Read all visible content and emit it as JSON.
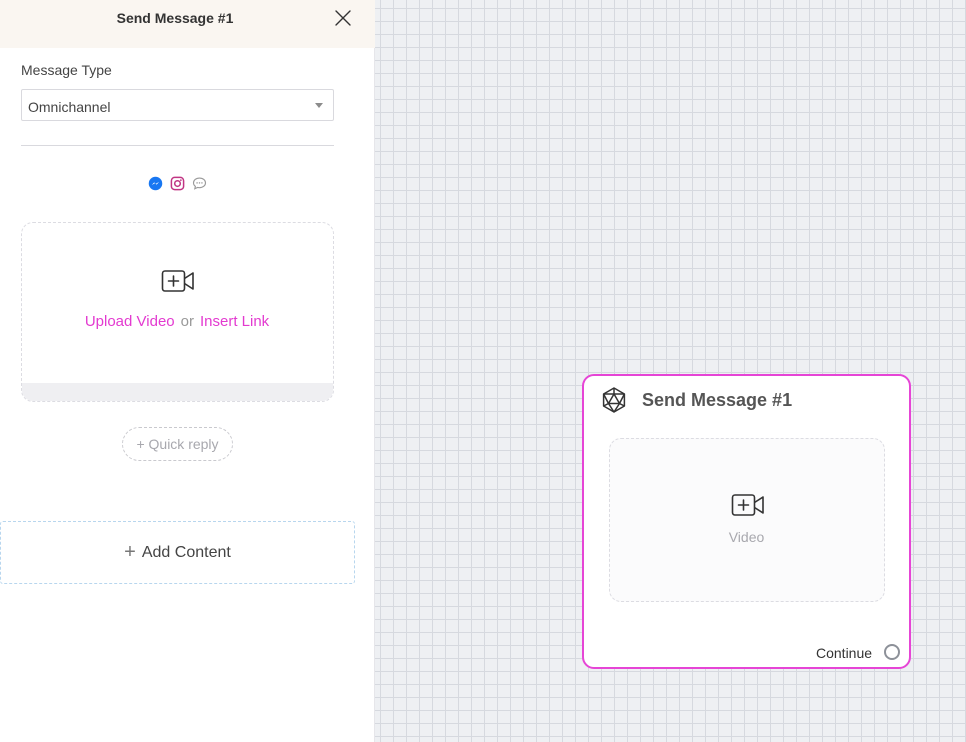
{
  "panel": {
    "title": "Send Message #1",
    "close_icon": "close-icon",
    "message_type": {
      "label": "Message Type",
      "value": "Omnichannel"
    },
    "channels": [
      {
        "name": "messenger",
        "icon": "messenger-icon",
        "color": "#1877f2"
      },
      {
        "name": "instagram",
        "icon": "instagram-icon",
        "color": "#c13584"
      },
      {
        "name": "sms",
        "icon": "chat-bubble-icon",
        "color": "#9a9a9a"
      }
    ],
    "upload": {
      "icon": "add-video-icon",
      "upload_label": "Upload Video",
      "or_label": "or",
      "link_label": "Insert Link"
    },
    "quick_reply_label": "+ Quick reply",
    "add_content": {
      "icon": "plus-icon",
      "label": "Add Content"
    }
  },
  "canvas": {
    "node": {
      "icon": "icosahedron-icon",
      "title": "Send Message #1",
      "video_icon": "add-video-icon",
      "video_label": "Video",
      "continue_label": "Continue",
      "border_color": "#e645d6"
    }
  },
  "colors": {
    "accent": "#e33ad0",
    "header_bg": "#faf6f1",
    "canvas_bg": "#eef0f3"
  }
}
